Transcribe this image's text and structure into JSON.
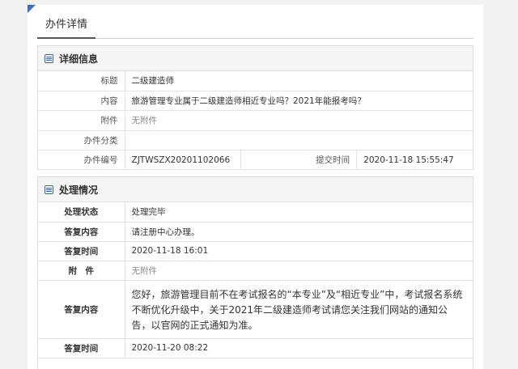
{
  "page": {
    "tab_label": "办件详情"
  },
  "detail": {
    "title": "详细信息",
    "rows": {
      "title_label": "标题",
      "title_value": "二级建造师",
      "content_label": "内容",
      "content_value": "旅游管理专业属于二级建造师相近专业吗？2021年能报考吗？",
      "attach_label": "附件",
      "attach_value": "无附件",
      "category_label": "办件分类",
      "category_value": "",
      "code_label": "办件编号",
      "code_value": "ZJTWSZX20201102066",
      "submit_label": "提交时间",
      "submit_value": "2020-11-18 15:55:47"
    }
  },
  "process": {
    "title": "处理情况",
    "rows": {
      "status_label": "处理状态",
      "status_value": "处理完毕",
      "reply1_label": "答复内容",
      "reply1_value": "请注册中心办理。",
      "time1_label": "答复时间",
      "time1_value": "2020-11-18 16:01",
      "attach_label": "附　件",
      "attach_value": "无附件",
      "reply2_label": "答复内容",
      "reply2_value": "您好，旅游管理目前不在考试报名的“本专业”及“相近专业”中，考试报名系统不断优化升级中，关于2021年二级建造师考试请您关注我们网站的通知公告，以官网的正式通知为准。",
      "time2_label": "答复时间",
      "time2_value": "2020-11-20 08:22"
    }
  },
  "colors": {
    "accent": "#3b6fbf",
    "icon": "#3a5fa8"
  }
}
